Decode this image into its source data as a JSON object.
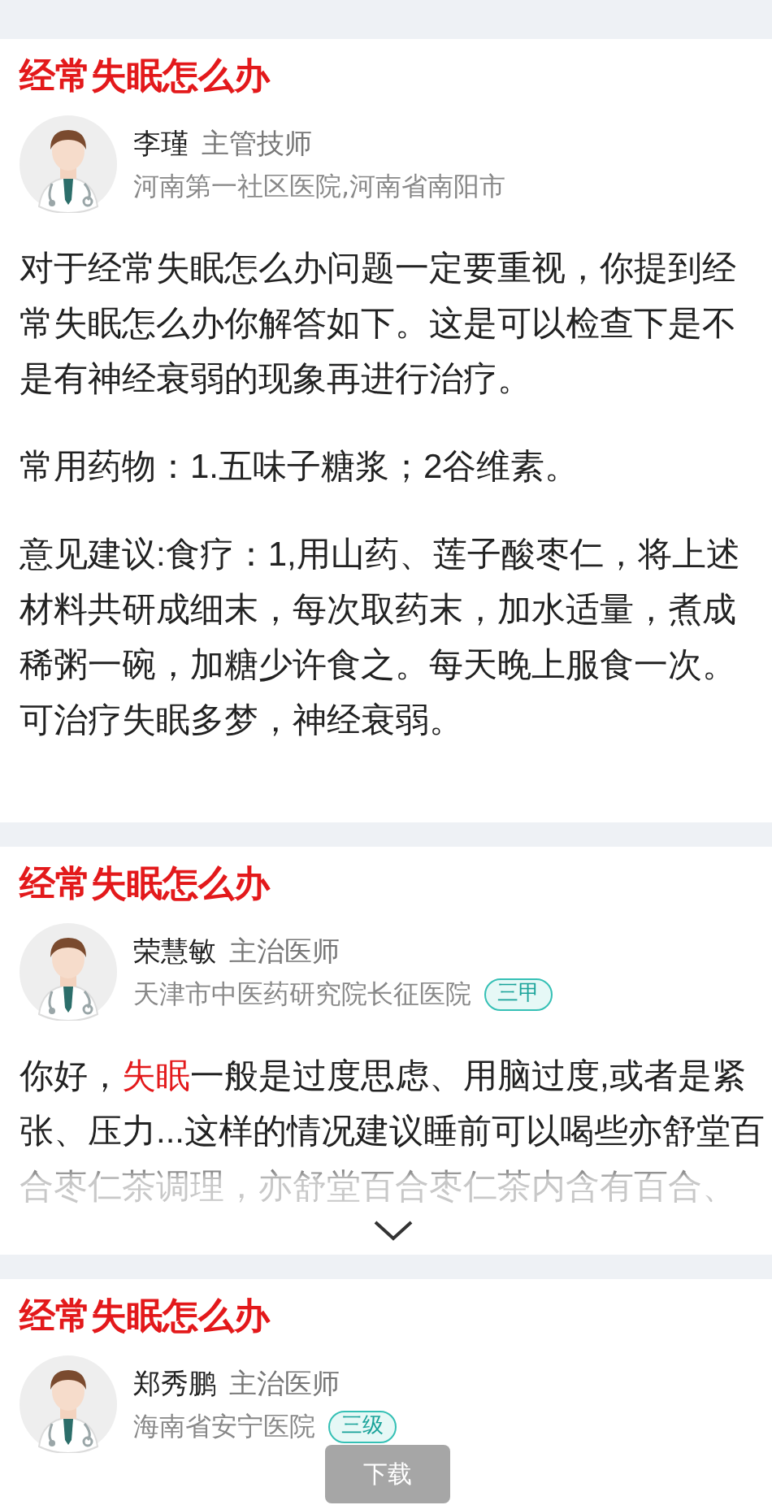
{
  "cards": [
    {
      "title": "经常失眠怎么办",
      "doctor": {
        "name": "李瑾",
        "title": "主管技师",
        "hospital": "河南第一社区医院,河南省南阳市"
      },
      "paragraphs": [
        [
          {
            "text": "对于经常失眠怎么办问题一定要重视，你提到经常失眠怎么办你解答如下。这是可以检查下是不是有神经衰弱的现象再进行治疗。",
            "highlight": false
          }
        ],
        [
          {
            "text": "常用药物：1.五味子糖浆；2谷维素。",
            "highlight": false
          }
        ],
        [
          {
            "text": "意见建议:食疗：1,用山药、莲子酸枣仁，将上述材料共研成细末，每次取药末，加水适量，煮成稀粥一碗，加糖少许食之。每天晚上服食一次。可治疗失眠多梦，神经衰弱。",
            "highlight": false
          }
        ]
      ]
    },
    {
      "title": "经常失眠怎么办",
      "doctor": {
        "name": "荣慧敏",
        "title": "主治医师",
        "hospital": "天津市中医药研究院长征医院",
        "badge": "三甲"
      },
      "collapsed": true,
      "paragraphs": [
        [
          {
            "text": "你好，",
            "highlight": false
          },
          {
            "text": "失眠",
            "highlight": true
          },
          {
            "text": "一般是过度思虑、用脑过度,或者是紧张、压力...这样的情况建议睡前可以喝些亦舒堂百合枣仁茶调理，亦舒堂百合枣仁茶内含有百合、",
            "highlight": false
          }
        ]
      ]
    },
    {
      "title": "经常失眠怎么办",
      "doctor": {
        "name": "郑秀鹏",
        "title": "主治医师",
        "hospital": "海南省安宁医院",
        "badge": "三级"
      }
    }
  ],
  "download_button": {
    "label": "下载"
  }
}
